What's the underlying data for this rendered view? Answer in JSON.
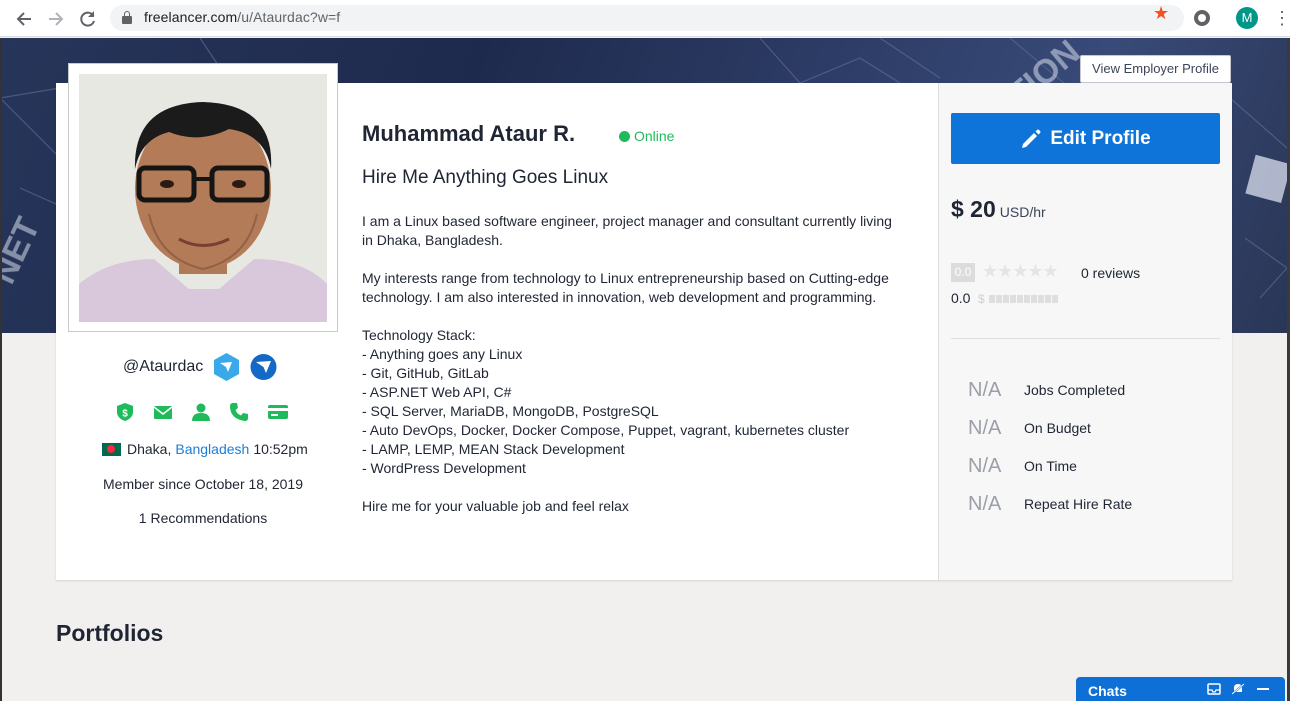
{
  "browser": {
    "url_host": "freelancer.com",
    "url_path": "/u/Ataurdac?w=f",
    "profile_initial": "M"
  },
  "header": {
    "view_employer_label": "View Employer Profile"
  },
  "profile": {
    "username": "@Ataurdac",
    "name": "Muhammad Ataur R.",
    "status": "Online",
    "tagline": "Hire Me Anything Goes Linux",
    "city": "Dhaka,",
    "country": "Bangladesh",
    "local_time": "10:52pm",
    "member_since": "Member since October 18, 2019",
    "recommendations": "1 Recommendations",
    "bio": "I am a Linux based software engineer, project manager and consultant currently living in Dhaka, Bangladesh.\n\nMy interests range from technology to Linux entrepreneurship based on Cutting-edge technology. I am also interested in innovation, web development and programming.\n\nTechnology Stack:\n- Anything goes any Linux\n- Git, GitHub, GitLab\n- ASP.NET Web API, C#\n- SQL Server, MariaDB, MongoDB, PostgreSQL\n- Auto DevOps, Docker, Docker Compose, Puppet, vagrant, kubernetes cluster\n- LAMP, LEMP, MEAN Stack Development\n- WordPress Development\n\nHire me for your valuable job and feel relax"
  },
  "sidebar": {
    "edit_label": "Edit Profile",
    "rate_value": "$ 20",
    "rate_unit": "USD/hr",
    "rating": "0.0",
    "stars_filled": 0,
    "reviews": "0 reviews",
    "earnings_score": "0.0",
    "stats": [
      {
        "value": "N/A",
        "label": "Jobs Completed"
      },
      {
        "value": "N/A",
        "label": "On Budget"
      },
      {
        "value": "N/A",
        "label": "On Time"
      },
      {
        "value": "N/A",
        "label": "Repeat Hire Rate"
      }
    ]
  },
  "sections": {
    "portfolios_title": "Portfolios"
  },
  "chats": {
    "label": "Chats"
  },
  "colors": {
    "accent": "#0e74d9",
    "online": "#1fbb5a",
    "link": "#1b7ed8",
    "verified": "#1fbb5a"
  },
  "icons": [
    "back-arrow-icon",
    "forward-arrow-icon",
    "reload-icon",
    "lock-icon",
    "star-icon",
    "extension-icon",
    "menu-icon",
    "pencil-icon",
    "shield-icon",
    "mail-icon",
    "user-icon",
    "phone-icon",
    "card-icon"
  ]
}
